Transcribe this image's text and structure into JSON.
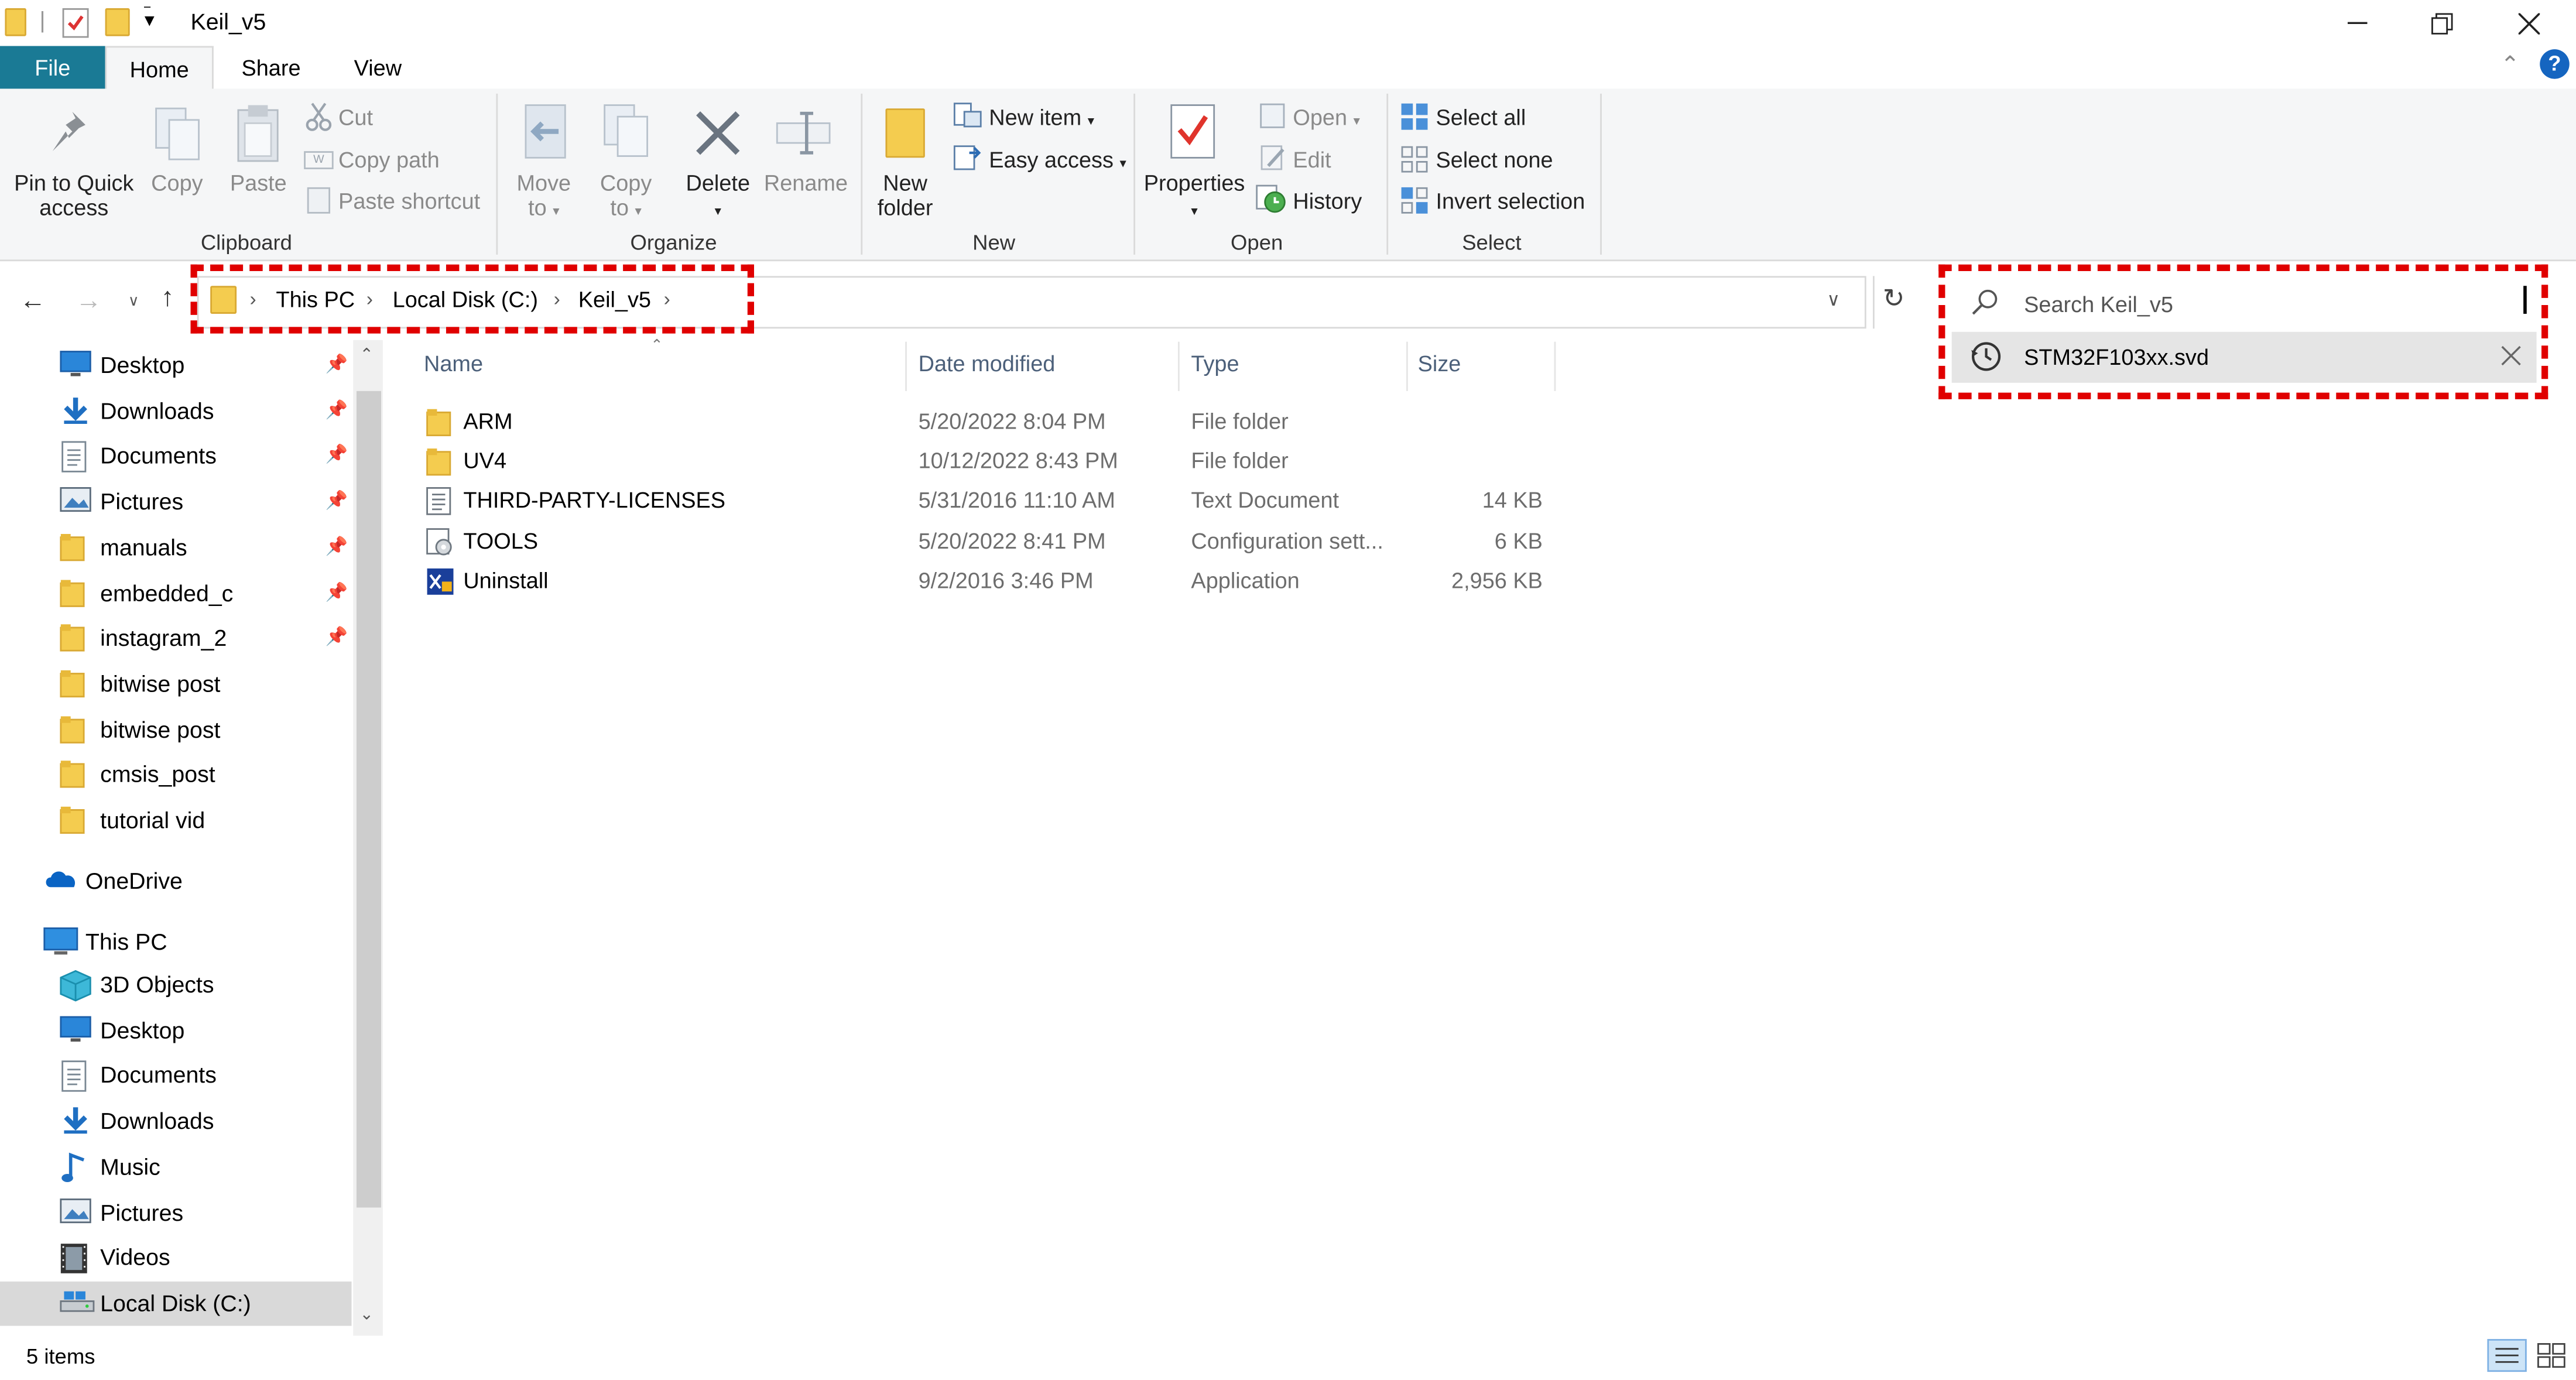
{
  "window": {
    "title": "Keil_v5"
  },
  "tabs": [
    {
      "key": "file",
      "label": "File"
    },
    {
      "key": "home",
      "label": "Home"
    },
    {
      "key": "share",
      "label": "Share"
    },
    {
      "key": "view",
      "label": "View"
    }
  ],
  "ribbon": {
    "clipboard": {
      "label": "Clipboard",
      "pin_line1": "Pin to Quick",
      "pin_line2": "access",
      "copy": "Copy",
      "paste": "Paste",
      "cut": "Cut",
      "copy_path": "Copy path",
      "paste_shortcut": "Paste shortcut"
    },
    "organize": {
      "label": "Organize",
      "move_line1": "Move",
      "move_line2": "to",
      "copyto_line1": "Copy",
      "copyto_line2": "to",
      "delete": "Delete",
      "rename": "Rename"
    },
    "new": {
      "label": "New",
      "new_folder_line1": "New",
      "new_folder_line2": "folder",
      "new_item": "New item",
      "easy_access": "Easy access"
    },
    "open": {
      "label": "Open",
      "properties": "Properties",
      "open": "Open",
      "edit": "Edit",
      "history": "History"
    },
    "select": {
      "label": "Select",
      "select_all": "Select all",
      "select_none": "Select none",
      "invert": "Invert selection"
    }
  },
  "address": {
    "crumbs": [
      "This PC",
      "Local Disk (C:)",
      "Keil_v5"
    ]
  },
  "search": {
    "placeholder": "Search Keil_v5",
    "suggestion": "STM32F103xx.svd"
  },
  "nav": {
    "quick": [
      {
        "label": "Desktop",
        "icon": "desktop-icon",
        "pinned": true
      },
      {
        "label": "Downloads",
        "icon": "downloads-icon",
        "pinned": true
      },
      {
        "label": "Documents",
        "icon": "documents-icon",
        "pinned": true
      },
      {
        "label": "Pictures",
        "icon": "pictures-icon",
        "pinned": true
      },
      {
        "label": "manuals",
        "icon": "folder-icon",
        "pinned": true
      },
      {
        "label": "embedded_c",
        "icon": "folder-icon",
        "pinned": true
      },
      {
        "label": "instagram_2",
        "icon": "folder-icon",
        "pinned": true
      },
      {
        "label": "bitwise post",
        "icon": "folder-icon",
        "pinned": false
      },
      {
        "label": "bitwise post",
        "icon": "folder-icon",
        "pinned": false
      },
      {
        "label": "cmsis_post",
        "icon": "folder-icon",
        "pinned": false
      },
      {
        "label": "tutorial vid",
        "icon": "folder-icon",
        "pinned": false
      }
    ],
    "onedrive": "OneDrive",
    "thispc": "This PC",
    "pc_items": [
      {
        "label": "3D Objects",
        "icon": "3d-objects-icon"
      },
      {
        "label": "Desktop",
        "icon": "desktop-icon"
      },
      {
        "label": "Documents",
        "icon": "documents-icon"
      },
      {
        "label": "Downloads",
        "icon": "downloads-icon"
      },
      {
        "label": "Music",
        "icon": "music-icon"
      },
      {
        "label": "Pictures",
        "icon": "pictures-icon"
      },
      {
        "label": "Videos",
        "icon": "videos-icon"
      },
      {
        "label": "Local Disk (C:)",
        "icon": "drive-icon"
      }
    ]
  },
  "columns": {
    "name": "Name",
    "date": "Date modified",
    "type": "Type",
    "size": "Size"
  },
  "files": [
    {
      "name": "ARM",
      "date": "5/20/2022 8:04 PM",
      "type": "File folder",
      "size": "",
      "icon": "folder-icon"
    },
    {
      "name": "UV4",
      "date": "10/12/2022 8:43 PM",
      "type": "File folder",
      "size": "",
      "icon": "folder-icon"
    },
    {
      "name": "THIRD-PARTY-LICENSES",
      "date": "5/31/2016 11:10 AM",
      "type": "Text Document",
      "size": "14 KB",
      "icon": "text-document-icon"
    },
    {
      "name": "TOOLS",
      "date": "5/20/2022 8:41 PM",
      "type": "Configuration sett...",
      "size": "6 KB",
      "icon": "config-file-icon"
    },
    {
      "name": "Uninstall",
      "date": "9/2/2016 3:46 PM",
      "type": "Application",
      "size": "2,956 KB",
      "icon": "application-icon"
    }
  ],
  "status": {
    "items": "5 items"
  },
  "colors": {
    "file_tab": "#1a7a95",
    "highlight": "#e00000",
    "accent": "#0078d7"
  }
}
